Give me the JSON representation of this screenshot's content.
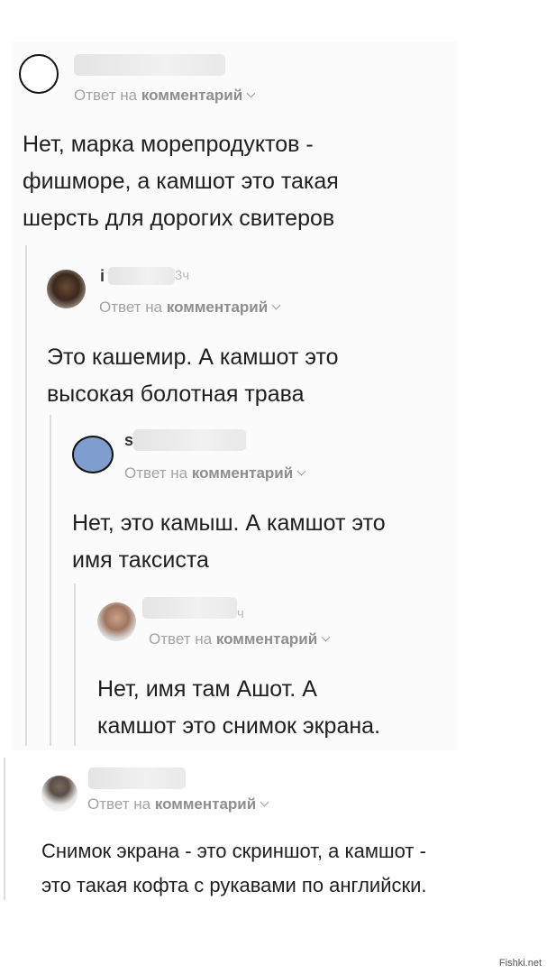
{
  "meta_prefix": "Ответ на ",
  "meta_link": "комментарий",
  "comments": [
    {
      "initial": "",
      "time": "",
      "text": "Нет, марка морепродуктов -\nфишморе, а камшот это такая\nшерсть для дорогих свитеров"
    },
    {
      "initial": "i",
      "time": "3ч",
      "text": "Это кашемир. А камшот это\nвысокая болотная трава"
    },
    {
      "initial": "s",
      "time": "",
      "text": "Нет, это камыш. А камшот это\nимя таксиста"
    },
    {
      "initial": "",
      "time": "ч",
      "text": "Нет, имя там Ашот. А\nкамшот это снимок экрана."
    },
    {
      "initial": "",
      "time": "",
      "text": "Снимок экрана - это скриншот, а камшот -\nэто такая кофта с рукавами по английски."
    }
  ],
  "watermark": "Fishki.net",
  "colors": {
    "avatar_blue": "#7f9ecf",
    "meta_gray": "#a3a3a3"
  }
}
